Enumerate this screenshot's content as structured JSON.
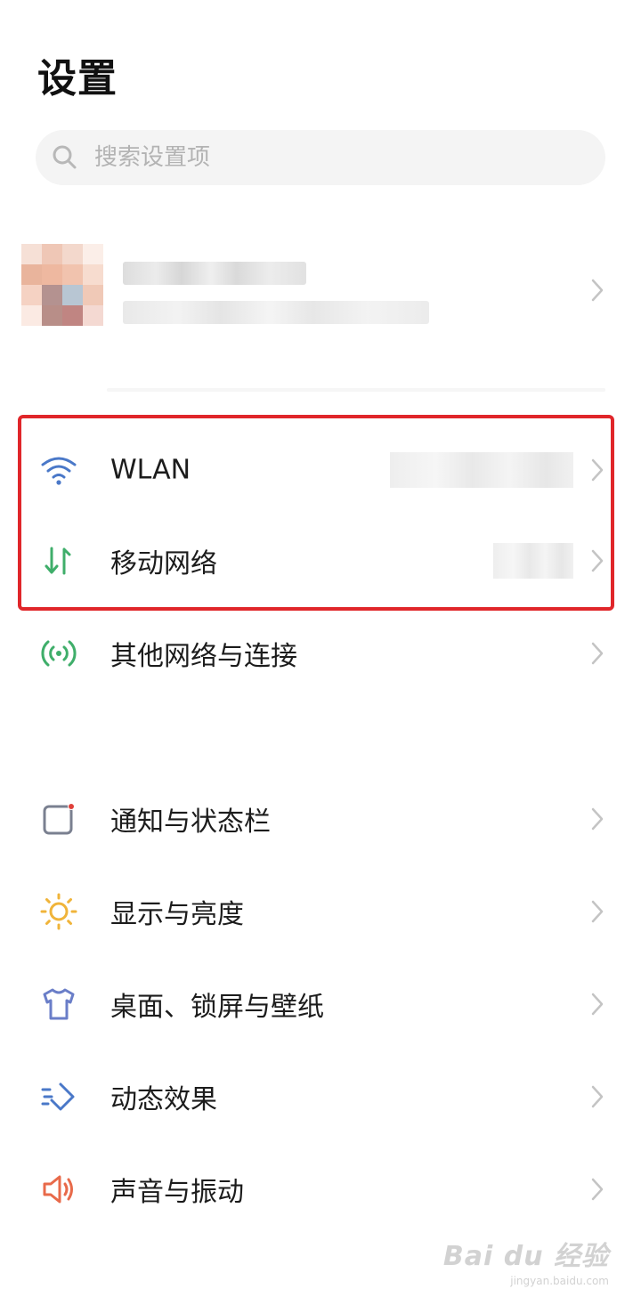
{
  "header": {
    "title": "设置"
  },
  "search": {
    "placeholder": "搜索设置项",
    "value": ""
  },
  "network_group": [
    {
      "id": "wlan",
      "label": "WLAN",
      "icon": "wifi-icon",
      "icon_color": "#4a78c8"
    },
    {
      "id": "mobile",
      "label": "移动网络",
      "icon": "mobile-data-icon",
      "icon_color": "#3fae6a"
    },
    {
      "id": "other",
      "label": "其他网络与连接",
      "icon": "connection-icon",
      "icon_color": "#3fae6a"
    }
  ],
  "settings_group": [
    {
      "id": "notification",
      "label": "通知与状态栏",
      "icon": "notification-icon",
      "icon_color": "#7a8090"
    },
    {
      "id": "display",
      "label": "显示与亮度",
      "icon": "sun-icon",
      "icon_color": "#f0b43a"
    },
    {
      "id": "desktop",
      "label": "桌面、锁屏与壁纸",
      "icon": "shirt-icon",
      "icon_color": "#6a7ec8"
    },
    {
      "id": "animation",
      "label": "动态效果",
      "icon": "motion-icon",
      "icon_color": "#4a78c8"
    },
    {
      "id": "sound",
      "label": "声音与振动",
      "icon": "speaker-icon",
      "icon_color": "#e86a4a"
    }
  ],
  "highlight_color": "#e0262a",
  "watermark": {
    "logo": "Bai du 经验",
    "url": "jingyan.baidu.com"
  }
}
